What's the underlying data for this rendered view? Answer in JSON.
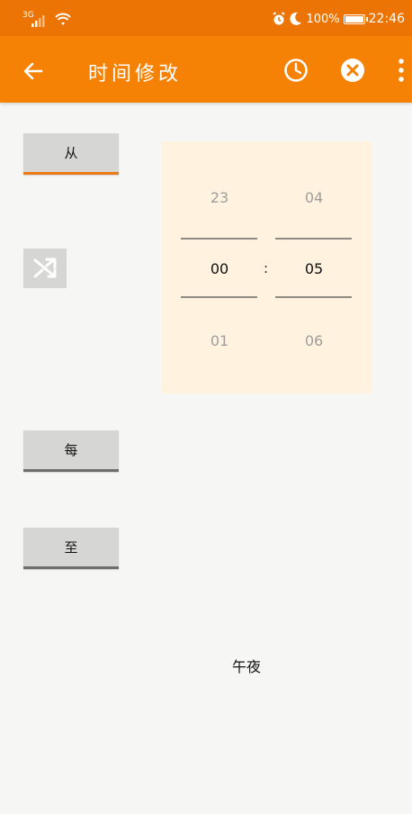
{
  "status_bar": {
    "network": "3G",
    "battery": "100%",
    "time": "22:46",
    "icons": [
      "signal-icon",
      "wifi-icon",
      "alarm-icon",
      "moon-icon",
      "battery-icon"
    ]
  },
  "app_bar": {
    "title": "时间修改",
    "icons": [
      "arrow-left-icon",
      "clock-icon",
      "cancel-circle-icon",
      "more-vert-icon"
    ]
  },
  "buttons": {
    "from_label": "从",
    "every_label": "每",
    "to_label": "至"
  },
  "picker": {
    "hours": {
      "prev": "23",
      "current": "00",
      "next": "01"
    },
    "minutes": {
      "prev": "04",
      "current": "05",
      "next": "06"
    },
    "separator": ":"
  },
  "summary_text": "午夜",
  "colors": {
    "status_bar": "#ec7404",
    "app_bar": "#f58204",
    "accent": "#ec7a17",
    "picker_bg": "#fff3e0"
  }
}
